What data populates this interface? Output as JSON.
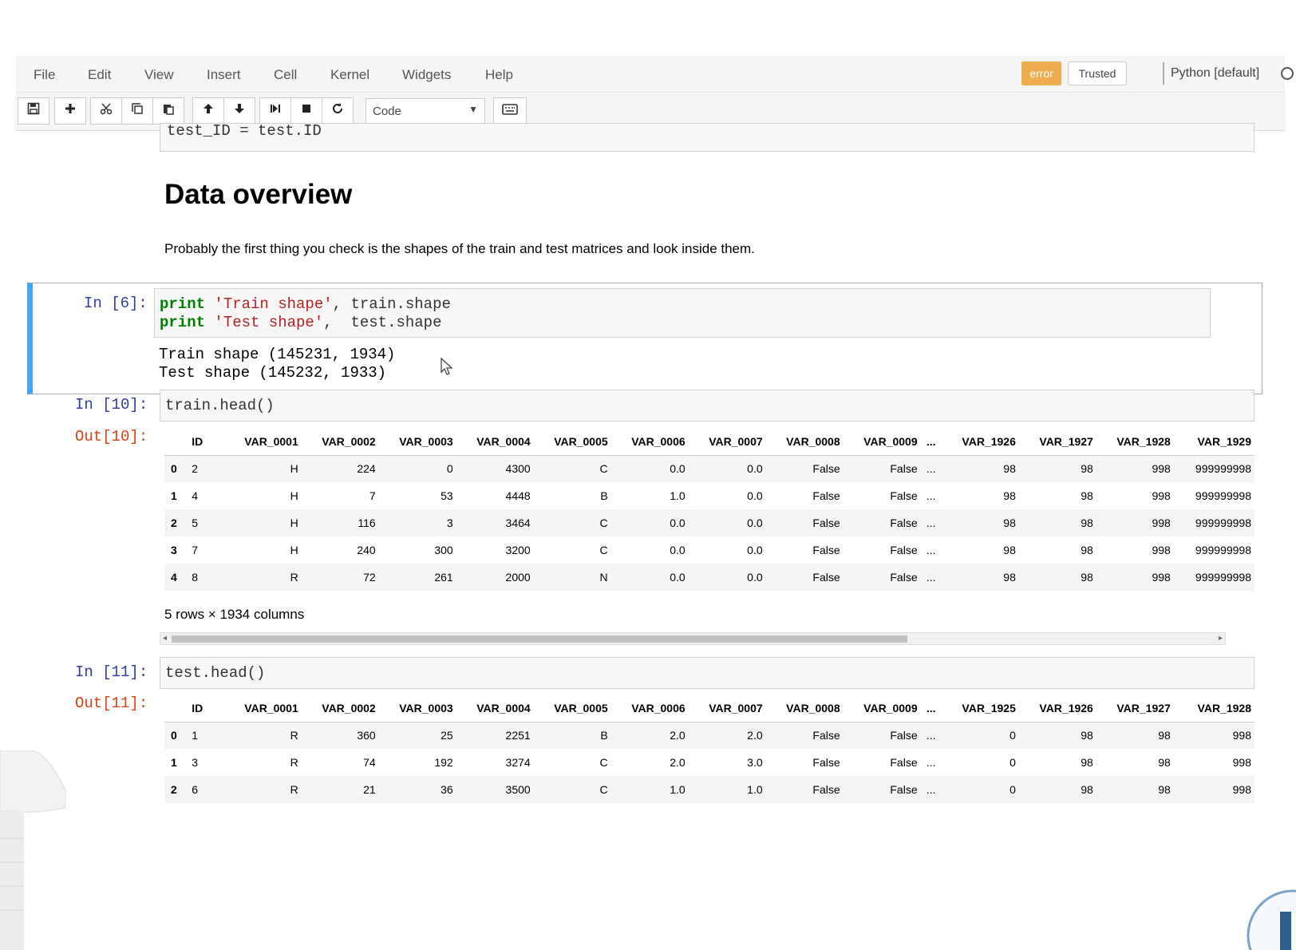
{
  "menubar": {
    "items": [
      "File",
      "Edit",
      "View",
      "Insert",
      "Cell",
      "Kernel",
      "Widgets",
      "Help"
    ],
    "kernel_status": "error",
    "trusted_label": "Trusted",
    "kernel_name": "Python [default]"
  },
  "toolbar": {
    "cell_type": "Code",
    "icons": [
      "save-icon",
      "plus-icon",
      "cut-icon",
      "copy-icon",
      "paste-icon",
      "arrow-up-icon",
      "arrow-down-icon",
      "run-next-icon",
      "stop-icon",
      "restart-icon",
      "keyboard-icon"
    ]
  },
  "notebook": {
    "prev_cell_code": "test_ID = test.ID",
    "heading": "Data overview",
    "paragraph": "Probably the first thing you check is the shapes of the train and test matrices and look inside them.",
    "cell6": {
      "prompt": "In [6]:",
      "line1": {
        "kw": "print",
        "str": " 'Train shape'",
        "rest": ", train.shape"
      },
      "line2": {
        "kw": "print",
        "str": " 'Test shape'",
        "rest": ",  test.shape"
      },
      "output1": "Train shape (145231, 1934)",
      "output2": "Test shape (145232, 1933)"
    },
    "cell10": {
      "prompt": "In [10]:",
      "code": "train.head()",
      "out_prompt": "Out[10]:",
      "columns": [
        "",
        "ID",
        "VAR_0001",
        "VAR_0002",
        "VAR_0003",
        "VAR_0004",
        "VAR_0005",
        "VAR_0006",
        "VAR_0007",
        "VAR_0008",
        "VAR_0009",
        "...",
        "VAR_1926",
        "VAR_1927",
        "VAR_1928",
        "VAR_1929"
      ],
      "rows": [
        [
          "0",
          "2",
          "H",
          "224",
          "0",
          "4300",
          "C",
          "0.0",
          "0.0",
          "False",
          "False",
          "...",
          "98",
          "98",
          "998",
          "999999998"
        ],
        [
          "1",
          "4",
          "H",
          "7",
          "53",
          "4448",
          "B",
          "1.0",
          "0.0",
          "False",
          "False",
          "...",
          "98",
          "98",
          "998",
          "999999998"
        ],
        [
          "2",
          "5",
          "H",
          "116",
          "3",
          "3464",
          "C",
          "0.0",
          "0.0",
          "False",
          "False",
          "...",
          "98",
          "98",
          "998",
          "999999998"
        ],
        [
          "3",
          "7",
          "H",
          "240",
          "300",
          "3200",
          "C",
          "0.0",
          "0.0",
          "False",
          "False",
          "...",
          "98",
          "98",
          "998",
          "999999998"
        ],
        [
          "4",
          "8",
          "R",
          "72",
          "261",
          "2000",
          "N",
          "0.0",
          "0.0",
          "False",
          "False",
          "...",
          "98",
          "98",
          "998",
          "999999998"
        ]
      ],
      "summary": "5 rows × 1934 columns"
    },
    "cell11": {
      "prompt": "In [11]:",
      "code": "test.head()",
      "out_prompt": "Out[11]:",
      "columns": [
        "",
        "ID",
        "VAR_0001",
        "VAR_0002",
        "VAR_0003",
        "VAR_0004",
        "VAR_0005",
        "VAR_0006",
        "VAR_0007",
        "VAR_0008",
        "VAR_0009",
        "...",
        "VAR_1925",
        "VAR_1926",
        "VAR_1927",
        "VAR_1928"
      ],
      "rows": [
        [
          "0",
          "1",
          "R",
          "360",
          "25",
          "2251",
          "B",
          "2.0",
          "2.0",
          "False",
          "False",
          "...",
          "0",
          "98",
          "98",
          "998"
        ],
        [
          "1",
          "3",
          "R",
          "74",
          "192",
          "3274",
          "C",
          "2.0",
          "3.0",
          "False",
          "False",
          "...",
          "0",
          "98",
          "98",
          "998"
        ],
        [
          "2",
          "6",
          "R",
          "21",
          "36",
          "3500",
          "C",
          "1.0",
          "1.0",
          "False",
          "False",
          "...",
          "0",
          "98",
          "98",
          "998"
        ]
      ]
    }
  }
}
